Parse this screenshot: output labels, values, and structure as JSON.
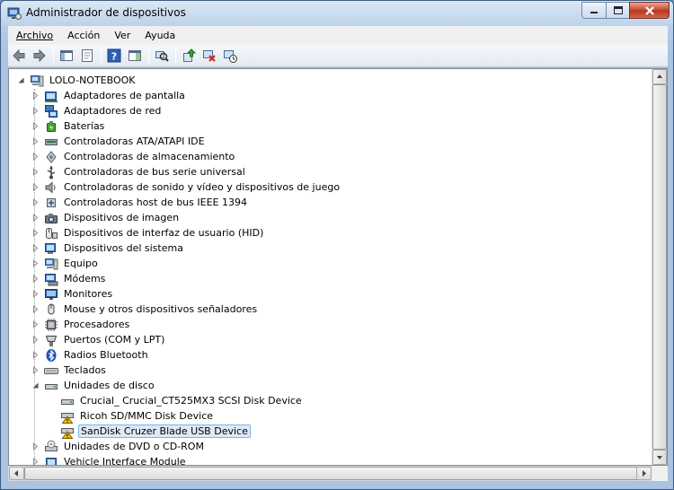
{
  "window": {
    "title": "Administrador de dispositivos"
  },
  "menu": [
    {
      "label": "Archivo",
      "hotkey_index": 0
    },
    {
      "label": "Acción",
      "hotkey_index": 0
    },
    {
      "label": "Ver",
      "hotkey_index": 0
    },
    {
      "label": "Ayuda",
      "hotkey_index": 1
    }
  ],
  "toolbar": {
    "buttons": [
      "back-icon",
      "forward-icon",
      "show-hide-console-tree-icon",
      "properties-sheet-icon",
      "help-icon",
      "show-action-pane-icon",
      "scan-hardware-icon",
      "update-driver-icon",
      "disable-device-icon",
      "uninstall-device-icon"
    ]
  },
  "tree": {
    "root": {
      "label": "LOLO-NOTEBOOK",
      "expanded": true,
      "icon": "computer-icon"
    },
    "categories": [
      {
        "label": "Adaptadores de pantalla",
        "icon": "display-adapter-icon"
      },
      {
        "label": "Adaptadores de red",
        "icon": "network-adapter-icon"
      },
      {
        "label": "Baterías",
        "icon": "battery-icon"
      },
      {
        "label": "Controladoras ATA/ATAPI IDE",
        "icon": "ide-controller-icon"
      },
      {
        "label": "Controladoras de almacenamiento",
        "icon": "storage-controller-icon"
      },
      {
        "label": "Controladoras de bus serie universal",
        "icon": "usb-icon"
      },
      {
        "label": "Controladoras de sonido y vídeo y dispositivos de juego",
        "icon": "sound-icon"
      },
      {
        "label": "Controladoras host de bus IEEE 1394",
        "icon": "ieee1394-icon"
      },
      {
        "label": "Dispositivos de imagen",
        "icon": "camera-icon"
      },
      {
        "label": "Dispositivos de interfaz de usuario (HID)",
        "icon": "hid-icon"
      },
      {
        "label": "Dispositivos del sistema",
        "icon": "system-device-icon"
      },
      {
        "label": "Equipo",
        "icon": "computer-icon"
      },
      {
        "label": "Módems",
        "icon": "modem-icon"
      },
      {
        "label": "Monitores",
        "icon": "monitor-icon"
      },
      {
        "label": "Mouse y otros dispositivos señaladores",
        "icon": "mouse-icon"
      },
      {
        "label": "Procesadores",
        "icon": "processor-icon"
      },
      {
        "label": "Puertos (COM y LPT)",
        "icon": "port-icon"
      },
      {
        "label": "Radios Bluetooth",
        "icon": "bluetooth-icon"
      },
      {
        "label": "Teclados",
        "icon": "keyboard-icon"
      },
      {
        "label": "Unidades de disco",
        "icon": "disk-drive-icon",
        "expanded": true,
        "children": [
          {
            "label": "Crucial_ Crucial_CT525MX3 SCSI Disk Device",
            "icon": "disk-drive-icon",
            "warning": false,
            "selected": false
          },
          {
            "label": "Ricoh SD/MMC Disk Device",
            "icon": "disk-drive-warning-icon",
            "warning": true,
            "selected": false
          },
          {
            "label": "SanDisk Cruzer Blade USB Device",
            "icon": "disk-drive-warning-icon",
            "warning": true,
            "selected": true
          }
        ]
      },
      {
        "label": "Unidades de DVD o CD-ROM",
        "icon": "dvd-drive-icon"
      },
      {
        "label": "Vehicle Interface Module",
        "icon": "vehicle-module-icon"
      }
    ]
  },
  "colors": {
    "selection_bg": "#dceaf8",
    "selection_border": "#7fb2e5",
    "warning": "#f2c200"
  }
}
